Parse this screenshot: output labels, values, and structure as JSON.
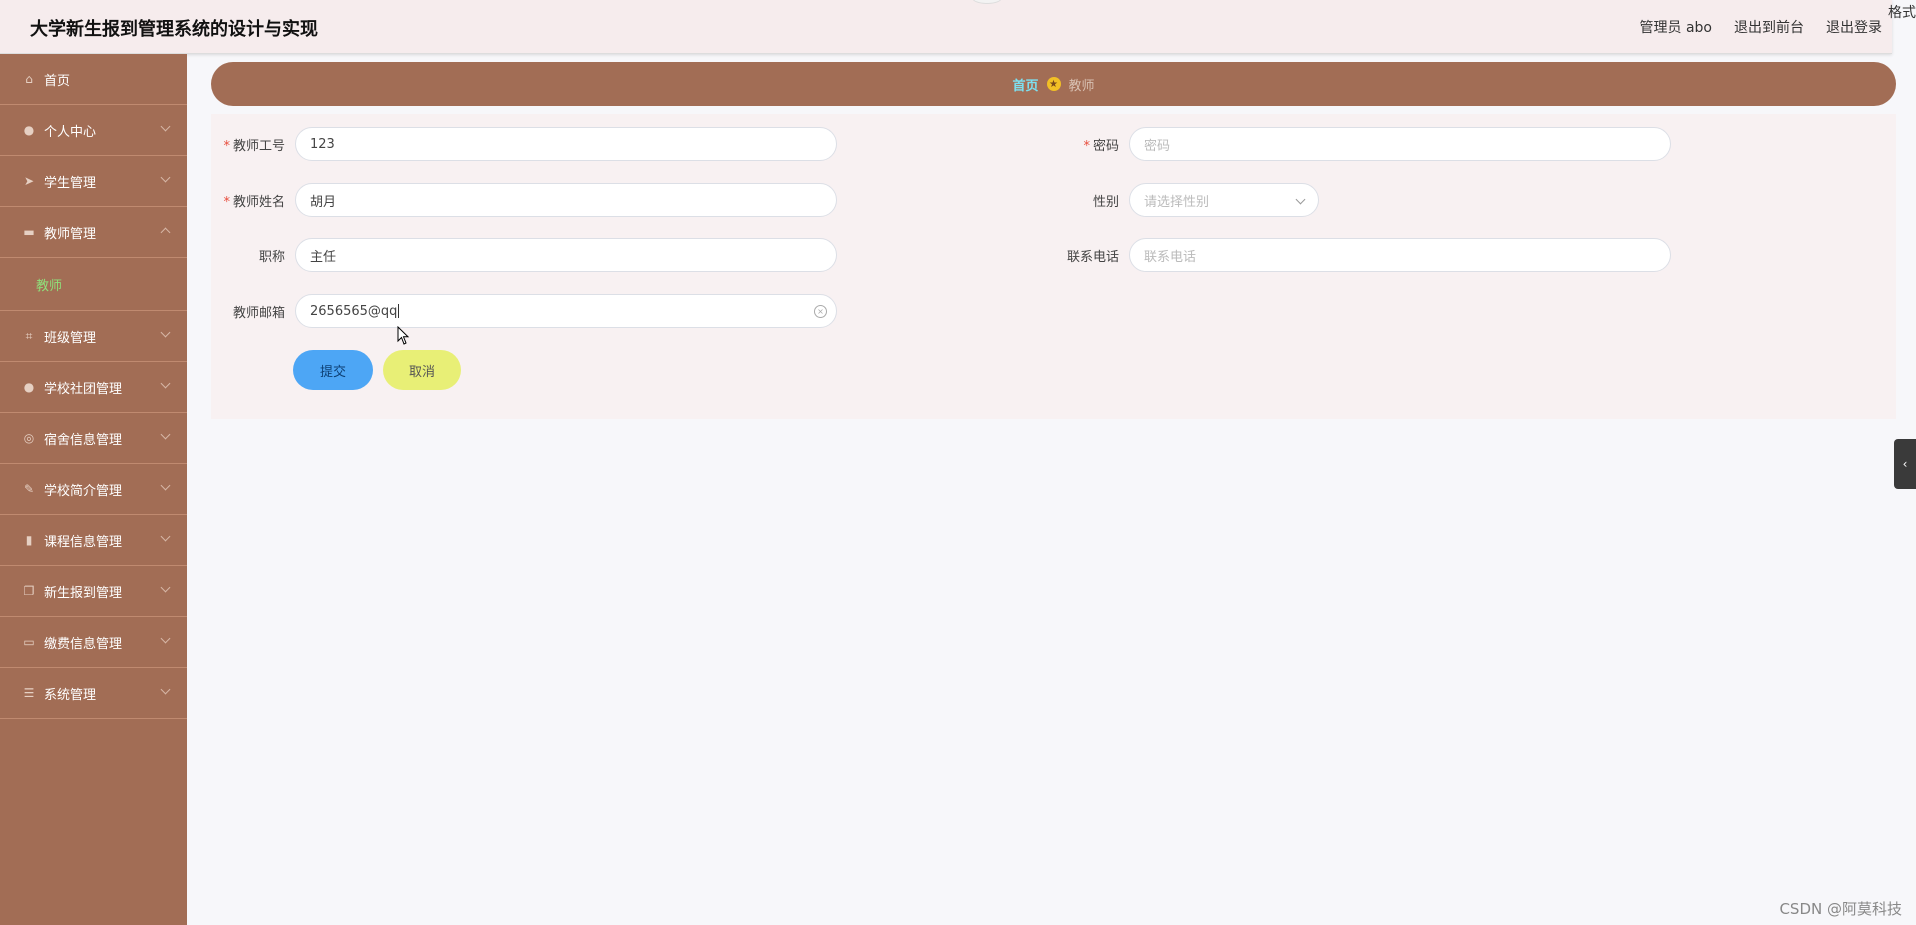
{
  "header": {
    "title": "大学新生报到管理系统的设计与实现",
    "admin_label": "管理员 abo",
    "front_label": "退出到前台",
    "logout_label": "退出登录",
    "edge_text": "格式"
  },
  "sidebar": {
    "items": [
      {
        "label": "首页",
        "icon": "home-icon"
      },
      {
        "label": "个人中心",
        "icon": "user-icon"
      },
      {
        "label": "学生管理",
        "icon": "send-icon"
      },
      {
        "label": "教师管理",
        "icon": "ticket-icon",
        "expanded": true
      },
      {
        "label": "班级管理",
        "icon": "crop-icon"
      },
      {
        "label": "学校社团管理",
        "icon": "user-icon"
      },
      {
        "label": "宿舍信息管理",
        "icon": "compass-icon"
      },
      {
        "label": "学校简介管理",
        "icon": "paint-icon"
      },
      {
        "label": "课程信息管理",
        "icon": "chart-icon"
      },
      {
        "label": "新生报到管理",
        "icon": "copy-icon"
      },
      {
        "label": "缴费信息管理",
        "icon": "monitor-icon"
      },
      {
        "label": "系统管理",
        "icon": "list-icon"
      }
    ],
    "sub_item": "教师"
  },
  "breadcrumb": {
    "home": "首页",
    "current": "教师"
  },
  "form": {
    "teacher_id": {
      "label": "教师工号",
      "value": "123",
      "required": true
    },
    "password": {
      "label": "密码",
      "placeholder": "密码",
      "required": true
    },
    "teacher_name": {
      "label": "教师姓名",
      "value": "胡月",
      "required": true
    },
    "gender": {
      "label": "性别",
      "placeholder": "请选择性别"
    },
    "title": {
      "label": "职称",
      "value": "主任"
    },
    "phone": {
      "label": "联系电话",
      "placeholder": "联系电话"
    },
    "email": {
      "label": "教师邮箱",
      "value": "2656565@qq"
    },
    "submit_label": "提交",
    "cancel_label": "取消"
  },
  "colors": {
    "sidebar_bg": "#a26d55",
    "submit": "#4da6f5",
    "cancel": "#e8ef76",
    "active_sub": "#8fe07a"
  },
  "watermark": "CSDN @阿莫科技"
}
